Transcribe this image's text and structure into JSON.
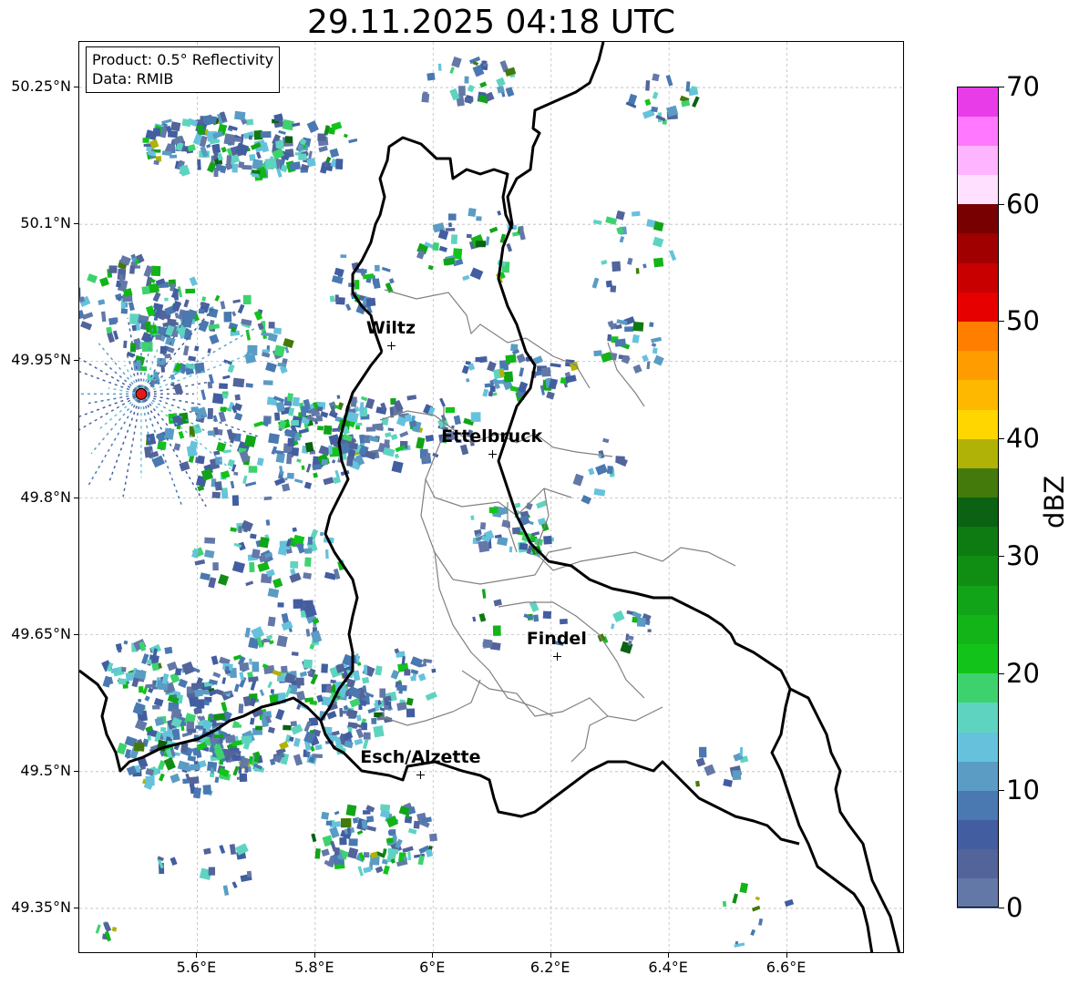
{
  "title": "29.11.2025 04:18 UTC",
  "info_box": {
    "product": "Product: 0.5° Reflectivity",
    "data_source": "Data: RMIB"
  },
  "map": {
    "extent": {
      "lon_min": 5.4,
      "lon_max": 6.8,
      "lat_min": 49.3,
      "lat_max": 50.3
    },
    "lat_ticks": [
      {
        "value": 50.25,
        "label": "50.25°N"
      },
      {
        "value": 50.1,
        "label": "50.1°N"
      },
      {
        "value": 49.95,
        "label": "49.95°N"
      },
      {
        "value": 49.8,
        "label": "49.8°N"
      },
      {
        "value": 49.65,
        "label": "49.65°N"
      },
      {
        "value": 49.5,
        "label": "49.5°N"
      },
      {
        "value": 49.35,
        "label": "49.35°N"
      }
    ],
    "lon_ticks": [
      {
        "value": 5.6,
        "label": "5.6°E"
      },
      {
        "value": 5.8,
        "label": "5.8°E"
      },
      {
        "value": 6.0,
        "label": "6°E"
      },
      {
        "value": 6.2,
        "label": "6.2°E"
      },
      {
        "value": 6.4,
        "label": "6.4°E"
      },
      {
        "value": 6.6,
        "label": "6.6°E"
      }
    ],
    "cities": [
      {
        "name": "Wiltz",
        "lon": 5.93,
        "lat": 49.966
      },
      {
        "name": "Ettelbruck",
        "lon": 6.101,
        "lat": 49.847
      },
      {
        "name": "Findel",
        "lon": 6.211,
        "lat": 49.626
      },
      {
        "name": "Esch/Alzette",
        "lon": 5.98,
        "lat": 49.496
      }
    ],
    "radar_site": {
      "lon": 5.505,
      "lat": 49.914,
      "color": "#e31a1c"
    },
    "border_color": "#000000",
    "district_color": "#808080",
    "grid": true
  },
  "colorbar": {
    "unit": "dBZ",
    "min": 0,
    "max": 70,
    "tick_values": [
      0,
      10,
      20,
      30,
      40,
      50,
      60,
      70
    ],
    "tick_labels": [
      "0",
      "10",
      "20",
      "30",
      "40",
      "50",
      "60",
      "70"
    ],
    "colors": [
      "#6478a8",
      "#52649a",
      "#425ea0",
      "#4a78b0",
      "#5a9cc4",
      "#66c2dc",
      "#5ed4c0",
      "#3ed26e",
      "#12c41a",
      "#12b418",
      "#12a418",
      "#108e14",
      "#0e7a12",
      "#0a6212",
      "#447a0c",
      "#b0b208",
      "#ffd600",
      "#ffb800",
      "#ff9c00",
      "#ff7e00",
      "#e60000",
      "#c80000",
      "#a00000",
      "#780000",
      "#ffe0ff",
      "#ffb4ff",
      "#ff78ff",
      "#e83ce8"
    ]
  }
}
